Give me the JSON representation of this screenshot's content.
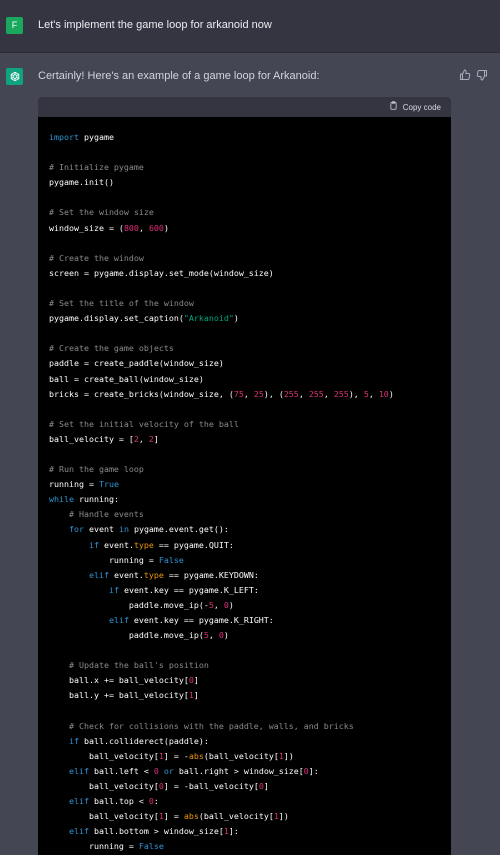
{
  "user_message": {
    "avatar_initial": "F",
    "text": "Let's implement the game loop for arkanoid now"
  },
  "assistant_message": {
    "text": "Certainly! Here's an example of a game loop for Arkanoid:",
    "icons": [
      "thumbs-up-icon",
      "thumbs-down-icon"
    ]
  },
  "code_block": {
    "copy_label": "Copy code",
    "language": "python",
    "lines": [
      [
        [
          "import",
          "kw"
        ],
        [
          " pygame",
          ""
        ]
      ],
      [],
      [
        [
          "# Initialize pygame",
          "cm"
        ]
      ],
      [
        [
          "pygame.init()",
          ""
        ]
      ],
      [],
      [
        [
          "# Set the window size",
          "cm"
        ]
      ],
      [
        [
          "window_size = (",
          ""
        ],
        [
          "800",
          "nu"
        ],
        [
          ", ",
          ""
        ],
        [
          "600",
          "nu"
        ],
        [
          ")",
          ""
        ]
      ],
      [],
      [
        [
          "# Create the window",
          "cm"
        ]
      ],
      [
        [
          "screen = pygame.display.set_mode(window_size)",
          ""
        ]
      ],
      [],
      [
        [
          "# Set the title of the window",
          "cm"
        ]
      ],
      [
        [
          "pygame.display.set_caption(",
          ""
        ],
        [
          "\"Arkanoid\"",
          "st"
        ],
        [
          ")",
          ""
        ]
      ],
      [],
      [
        [
          "# Create the game objects",
          "cm"
        ]
      ],
      [
        [
          "paddle = create_paddle(window_size)",
          ""
        ]
      ],
      [
        [
          "ball = create_ball(window_size)",
          ""
        ]
      ],
      [
        [
          "bricks = create_bricks(window_size, (",
          ""
        ],
        [
          "75",
          "nu"
        ],
        [
          ", ",
          ""
        ],
        [
          "25",
          "nu"
        ],
        [
          "), (",
          ""
        ],
        [
          "255",
          "nu"
        ],
        [
          ", ",
          ""
        ],
        [
          "255",
          "nu"
        ],
        [
          ", ",
          ""
        ],
        [
          "255",
          "nu"
        ],
        [
          "), ",
          ""
        ],
        [
          "5",
          "nu"
        ],
        [
          ", ",
          ""
        ],
        [
          "10",
          "nu"
        ],
        [
          ")",
          ""
        ]
      ],
      [],
      [
        [
          "# Set the initial velocity of the ball",
          "cm"
        ]
      ],
      [
        [
          "ball_velocity = [",
          ""
        ],
        [
          "2",
          "nu"
        ],
        [
          ", ",
          ""
        ],
        [
          "2",
          "nu"
        ],
        [
          "]",
          ""
        ]
      ],
      [],
      [
        [
          "# Run the game loop",
          "cm"
        ]
      ],
      [
        [
          "running = ",
          ""
        ],
        [
          "True",
          "kw"
        ]
      ],
      [
        [
          "while",
          "kw"
        ],
        [
          " running:",
          ""
        ]
      ],
      [
        [
          "    ",
          ""
        ],
        [
          "# Handle events",
          "cm"
        ]
      ],
      [
        [
          "    ",
          ""
        ],
        [
          "for",
          "kw"
        ],
        [
          " event ",
          ""
        ],
        [
          "in",
          "kw"
        ],
        [
          " pygame.event.get():",
          ""
        ]
      ],
      [
        [
          "        ",
          ""
        ],
        [
          "if",
          "kw"
        ],
        [
          " event.",
          ""
        ],
        [
          "type",
          "at"
        ],
        [
          " == pygame.QUIT:",
          ""
        ]
      ],
      [
        [
          "            running = ",
          ""
        ],
        [
          "False",
          "kw"
        ]
      ],
      [
        [
          "        ",
          ""
        ],
        [
          "elif",
          "kw"
        ],
        [
          " event.",
          ""
        ],
        [
          "type",
          "at"
        ],
        [
          " == pygame.KEYDOWN:",
          ""
        ]
      ],
      [
        [
          "            ",
          ""
        ],
        [
          "if",
          "kw"
        ],
        [
          " event.key == pygame.K_LEFT:",
          ""
        ]
      ],
      [
        [
          "                paddle.move_ip(-",
          ""
        ],
        [
          "5",
          "nu"
        ],
        [
          ", ",
          ""
        ],
        [
          "0",
          "nu"
        ],
        [
          ")",
          ""
        ]
      ],
      [
        [
          "            ",
          ""
        ],
        [
          "elif",
          "kw"
        ],
        [
          " event.key == pygame.K_RIGHT:",
          ""
        ]
      ],
      [
        [
          "                paddle.move_ip(",
          ""
        ],
        [
          "5",
          "nu"
        ],
        [
          ", ",
          ""
        ],
        [
          "0",
          "nu"
        ],
        [
          ")",
          ""
        ]
      ],
      [],
      [
        [
          "    ",
          ""
        ],
        [
          "# Update the ball's position",
          "cm"
        ]
      ],
      [
        [
          "    ball.x += ball_velocity[",
          ""
        ],
        [
          "0",
          "nu"
        ],
        [
          "]",
          ""
        ]
      ],
      [
        [
          "    ball.y += ball_velocity[",
          ""
        ],
        [
          "1",
          "nu"
        ],
        [
          "]",
          ""
        ]
      ],
      [],
      [
        [
          "    ",
          ""
        ],
        [
          "# Check for collisions with the paddle, walls, and bricks",
          "cm"
        ]
      ],
      [
        [
          "    ",
          ""
        ],
        [
          "if",
          "kw"
        ],
        [
          " ball.colliderect(paddle):",
          ""
        ]
      ],
      [
        [
          "        ball_velocity[",
          ""
        ],
        [
          "1",
          "nu"
        ],
        [
          "] = -",
          ""
        ],
        [
          "abs",
          "at"
        ],
        [
          "(ball_velocity[",
          ""
        ],
        [
          "1",
          "nu"
        ],
        [
          "])",
          ""
        ]
      ],
      [
        [
          "    ",
          ""
        ],
        [
          "elif",
          "kw"
        ],
        [
          " ball.left < ",
          ""
        ],
        [
          "0",
          "nu"
        ],
        [
          " ",
          ""
        ],
        [
          "or",
          "kw"
        ],
        [
          " ball.right > window_size[",
          ""
        ],
        [
          "0",
          "nu"
        ],
        [
          "]:",
          ""
        ]
      ],
      [
        [
          "        ball_velocity[",
          ""
        ],
        [
          "0",
          "nu"
        ],
        [
          "] = -ball_velocity[",
          ""
        ],
        [
          "0",
          "nu"
        ],
        [
          "]",
          ""
        ]
      ],
      [
        [
          "    ",
          ""
        ],
        [
          "elif",
          "kw"
        ],
        [
          " ball.top < ",
          ""
        ],
        [
          "0",
          "nu"
        ],
        [
          ":",
          ""
        ]
      ],
      [
        [
          "        ball_velocity[",
          ""
        ],
        [
          "1",
          "nu"
        ],
        [
          "] = ",
          ""
        ],
        [
          "abs",
          "at"
        ],
        [
          "(ball_velocity[",
          ""
        ],
        [
          "1",
          "nu"
        ],
        [
          "])",
          ""
        ]
      ],
      [
        [
          "    ",
          ""
        ],
        [
          "elif",
          "kw"
        ],
        [
          " ball.bottom > window_size[",
          ""
        ],
        [
          "1",
          "nu"
        ],
        [
          "]:",
          ""
        ]
      ],
      [
        [
          "        running = ",
          ""
        ],
        [
          "False",
          "kw"
        ]
      ]
    ]
  }
}
